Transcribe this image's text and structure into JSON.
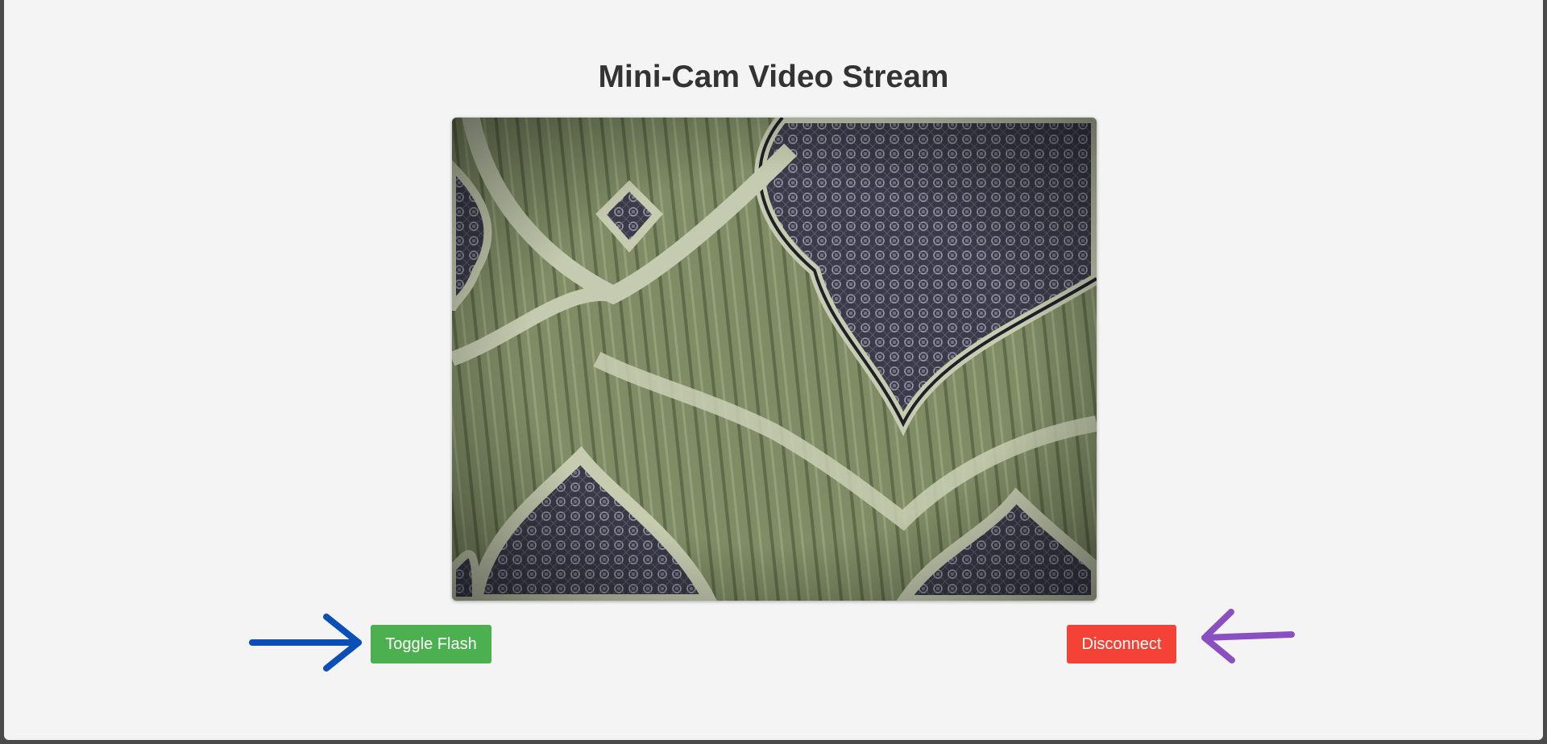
{
  "page": {
    "title": "Mini-Cam Video Stream",
    "background_color": "#f4f4f4"
  },
  "stream": {
    "kind": "live-camera-frame",
    "subject": "ornate damask fabric pattern"
  },
  "controls": {
    "toggle_flash_label": "Toggle Flash",
    "toggle_flash_color": "#4caf50",
    "disconnect_label": "Disconnect",
    "disconnect_color": "#f44336"
  },
  "annotations": {
    "left_arrow_color": "#0a4fb8",
    "left_arrow_direction": "right",
    "right_arrow_color": "#8a4fc0",
    "right_arrow_direction": "left"
  }
}
